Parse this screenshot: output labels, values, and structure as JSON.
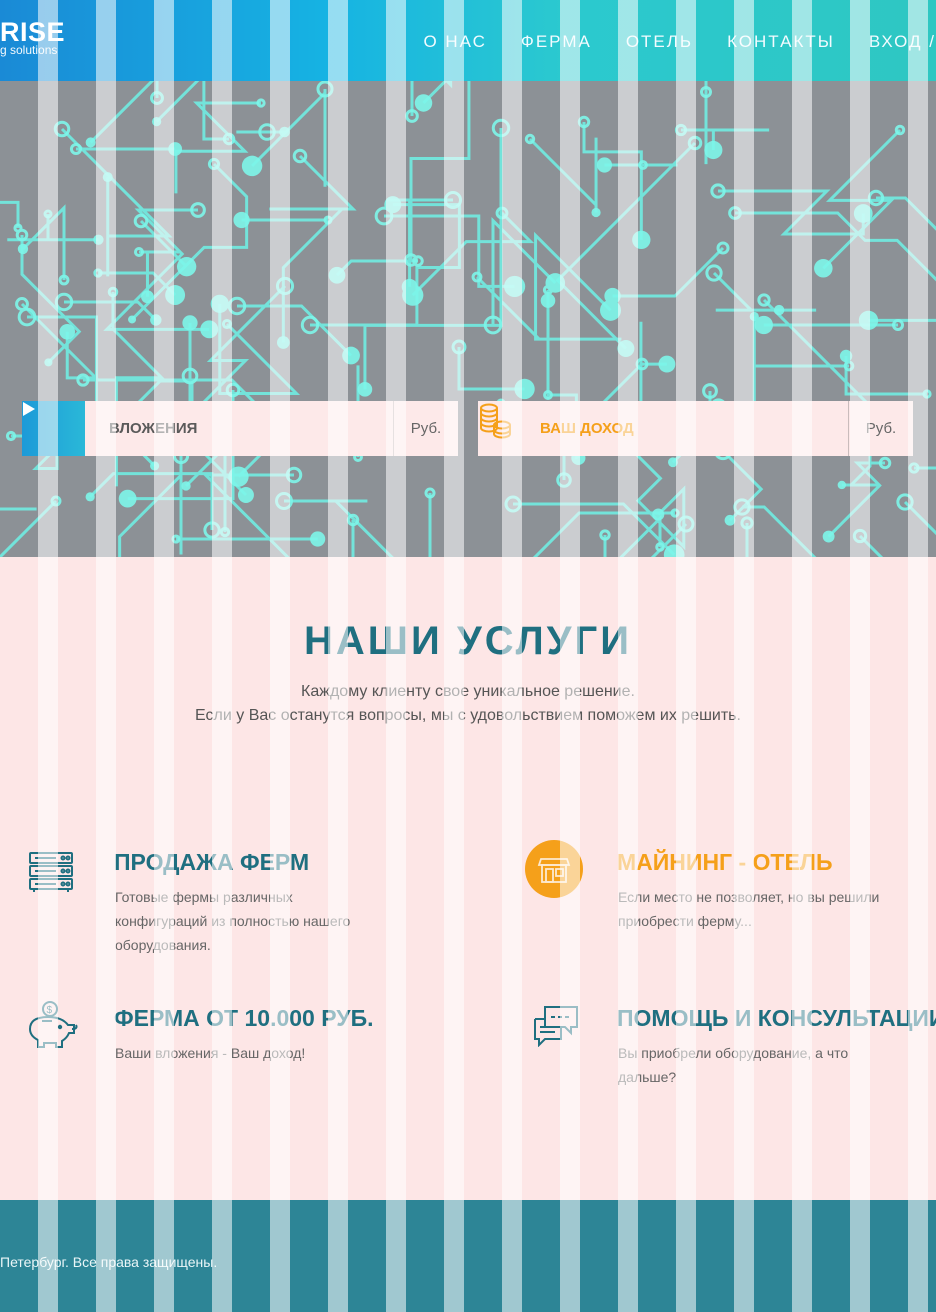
{
  "header": {
    "logo_main": "RISE",
    "logo_sub": "g solutions",
    "nav": [
      "О НАС",
      "ФЕРМА",
      "ОТЕЛЬ",
      "КОНТАКТЫ",
      "ВХОД /"
    ]
  },
  "hero": {
    "investment_label": "ВЛОЖЕНИЯ",
    "investment_unit": "Руб.",
    "income_label": "ВАШ ДОХОД",
    "income_unit": "Руб."
  },
  "services": {
    "title": "НАШИ УСЛУГИ",
    "subtitle_line1": "Каждому клиенту свое уникальное решение.",
    "subtitle_line2": "Если у Вас останутся вопросы, мы с удовольствием поможем их решить.",
    "items": [
      {
        "title": "ПРОДАЖА ФЕРМ",
        "text_line1": "Готовые фермы различных",
        "text_line2": "конфигураций из полностью нашего",
        "text_line3": "оборудования.",
        "icon": "server-rack-icon"
      },
      {
        "title": "МАЙНИНГ - ОТЕЛЬ",
        "text_line1": "Если место не позволяет, но вы решили",
        "text_line2": "приобрести ферму...",
        "icon": "store-icon"
      },
      {
        "title": "ФЕРМА ОТ 10.000 РУБ.",
        "text_line1": "Ваши вложения - Ваш доход!",
        "icon": "piggy-bank-icon"
      },
      {
        "title": "ПОМОЩЬ И КОНСУЛЬТАЦИИ",
        "text_line1": "Вы приобрели оборудование,  а что",
        "text_line2": "дальше?",
        "icon": "chat-bubbles-icon"
      }
    ]
  },
  "footer": {
    "copyright": "Петербург. Все права защищены."
  },
  "colors": {
    "accent_teal": "#1f6f80",
    "accent_orange": "#f5a01a",
    "header_blue": "#16b3e3",
    "footer": "#2d8596"
  }
}
